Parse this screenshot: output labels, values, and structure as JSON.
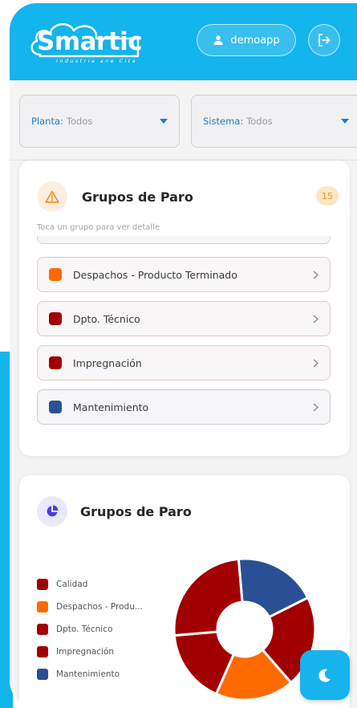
{
  "header": {
    "logo_text": "Smartic",
    "logo_tagline": "Industria ane Cita",
    "user_name": "demoapp",
    "user_icon": "person-icon",
    "logout_icon": "logout-icon"
  },
  "filters": {
    "planta": {
      "label": "Planta:",
      "value": "Todos"
    },
    "sistema": {
      "label": "Sistema:",
      "value": "Todos"
    }
  },
  "groups_card": {
    "title": "Grupos de Paro",
    "count": "15",
    "hint": "Toca un grupo para ver detalle",
    "icon": "warning-icon",
    "items": [
      {
        "label": "Despachos - Producto Terminado",
        "color": "#ff6a00"
      },
      {
        "label": "Dpto. Técnico",
        "color": "#a10000"
      },
      {
        "label": "Impregnación",
        "color": "#a10000"
      },
      {
        "label": "Mantenimiento",
        "color": "#2a4f95"
      }
    ]
  },
  "chart_card": {
    "title": "Grupos de Paro",
    "icon": "pie-chart-icon"
  },
  "chart_data": {
    "type": "pie",
    "categories": [
      "Calidad",
      "Despachos - Produ...",
      "Dpto. Técnico",
      "Impregnación",
      "Mantenimiento"
    ],
    "values": [
      25,
      18,
      17,
      21,
      19
    ],
    "colors": [
      "#a10000",
      "#ff6a00",
      "#a10000",
      "#a10000",
      "#2a4f95"
    ],
    "legend_position": "left"
  },
  "fab": {
    "icon": "moon-icon"
  },
  "colors": {
    "primary": "#14b4ec",
    "filter_label": "#1a7fc2",
    "badge_bg": "#fde6c4",
    "badge_text": "#e0962a"
  }
}
